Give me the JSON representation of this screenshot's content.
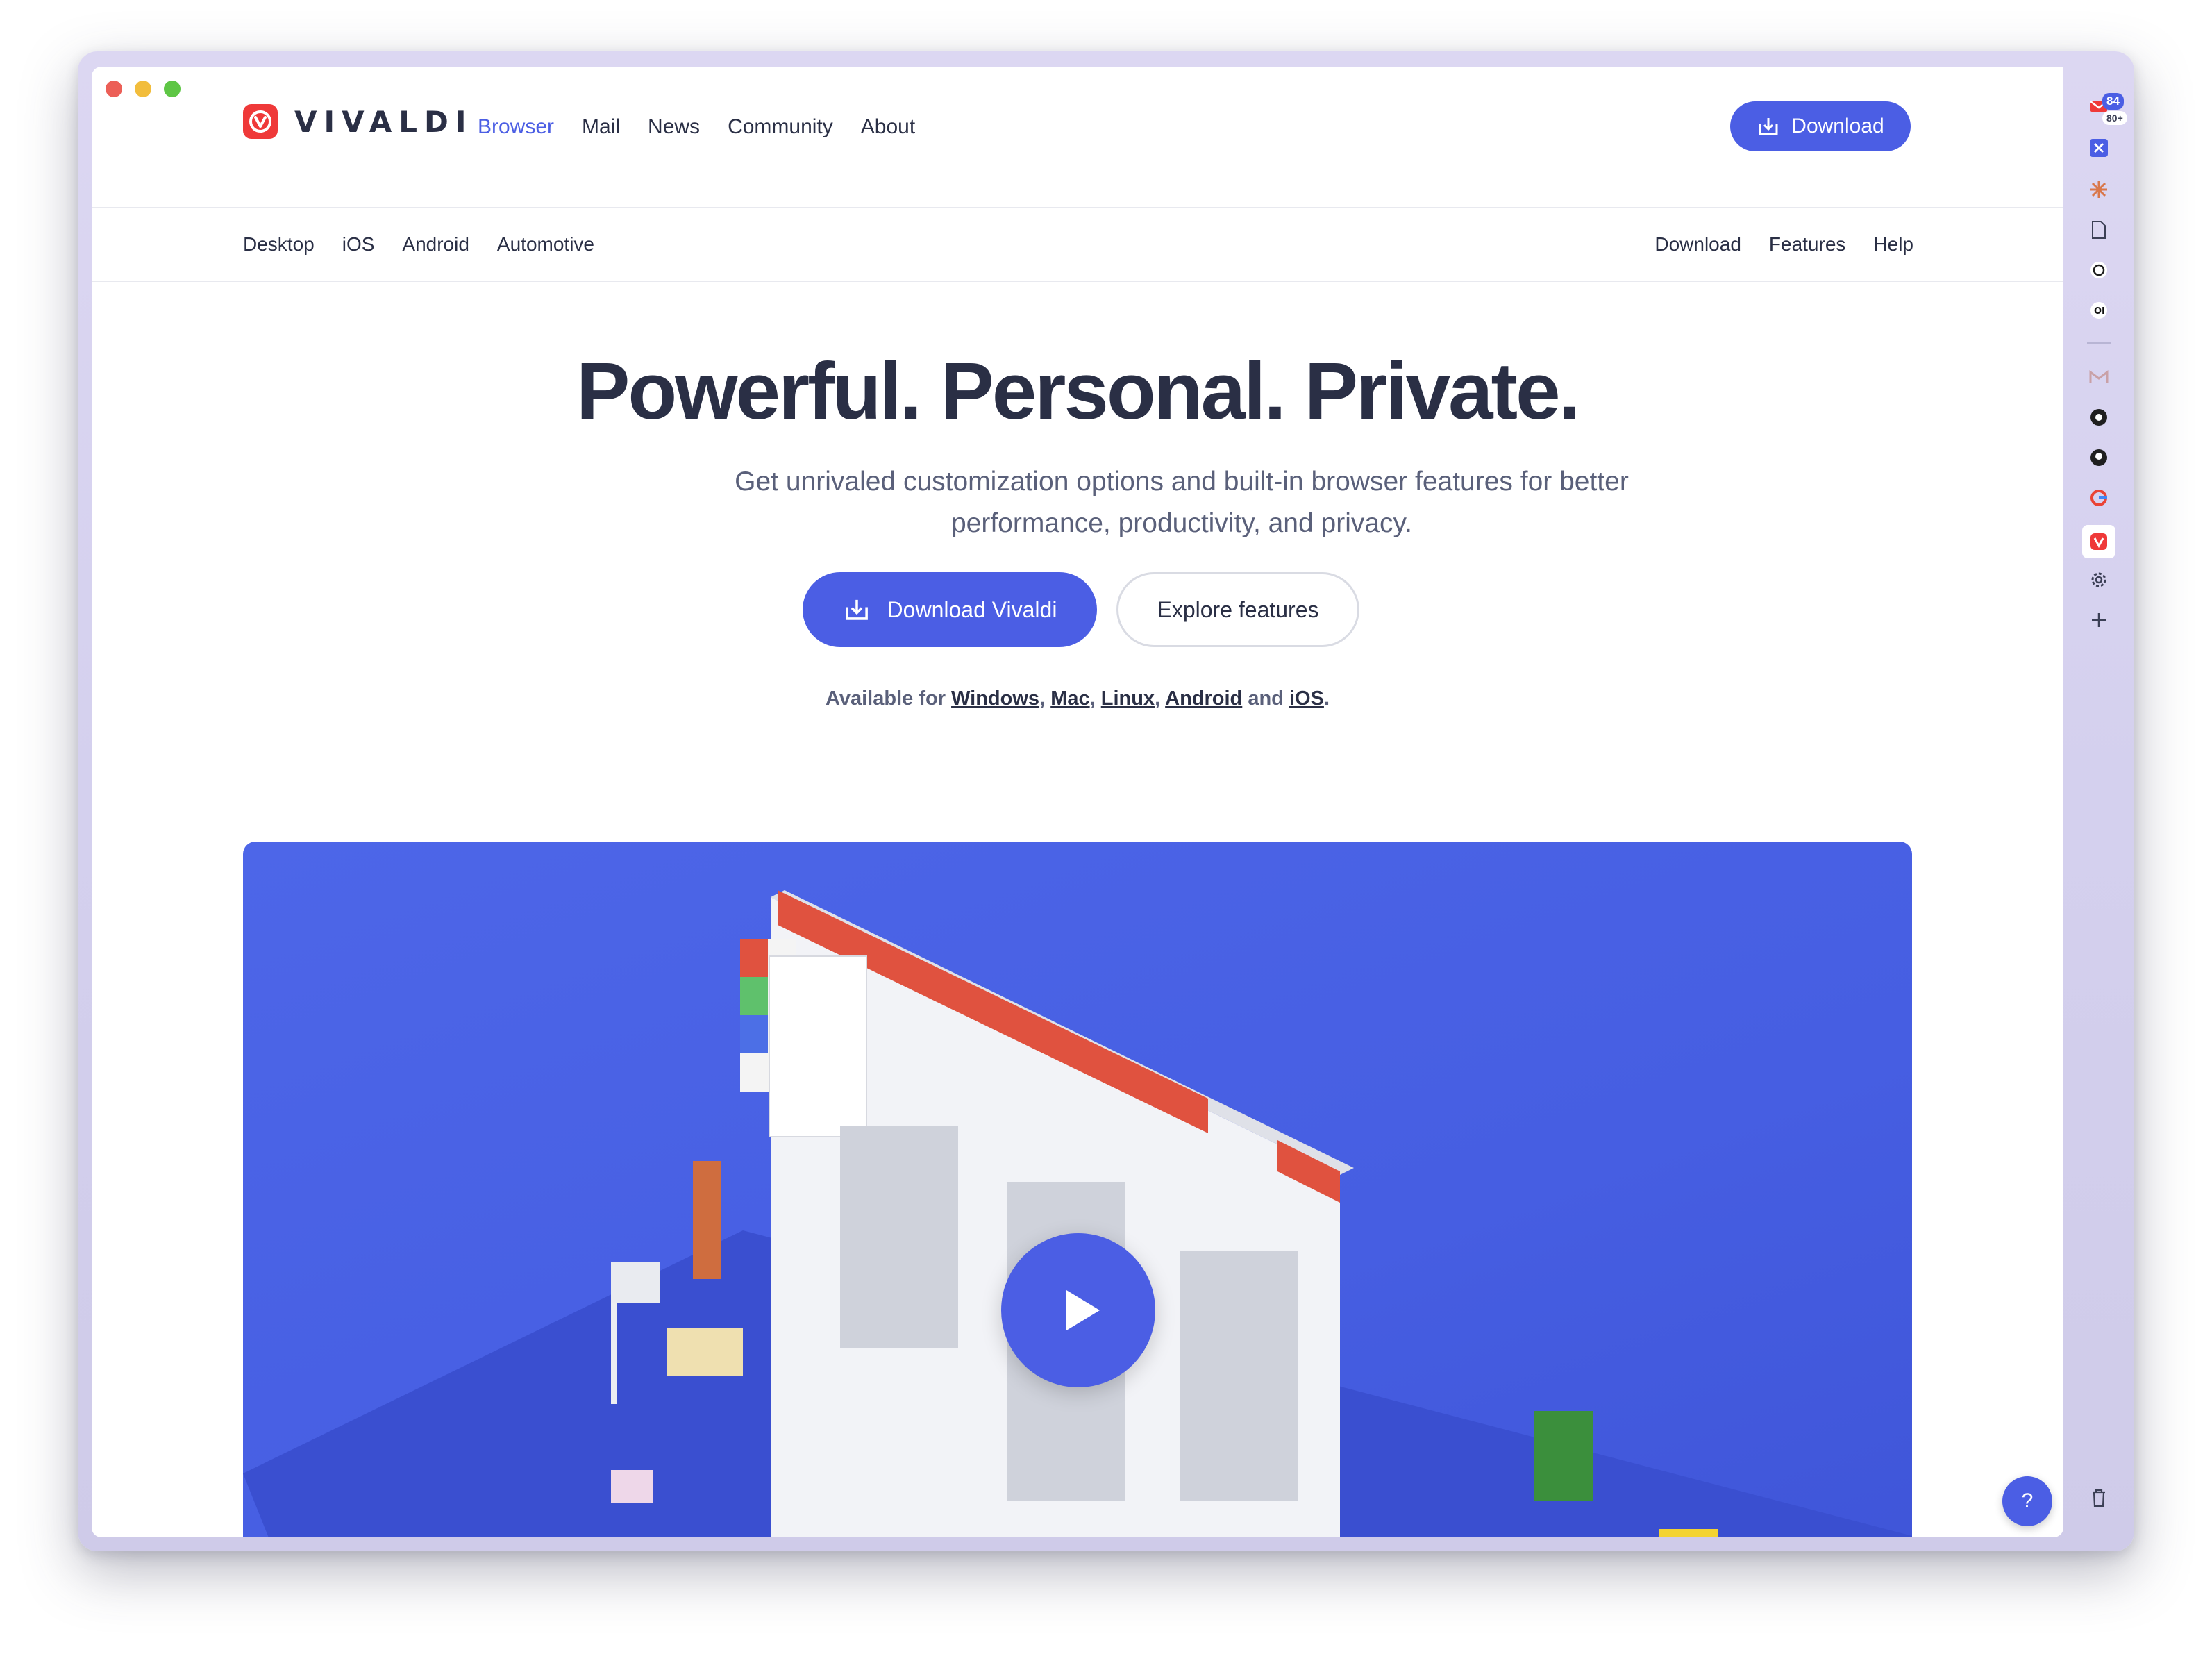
{
  "window": {
    "traffic_lights": [
      "close",
      "minimize",
      "maximize"
    ]
  },
  "nav": {
    "logo_text": "VIVALDI",
    "links": [
      {
        "label": "Browser",
        "active": true
      },
      {
        "label": "Mail",
        "active": false
      },
      {
        "label": "News",
        "active": false
      },
      {
        "label": "Community",
        "active": false
      },
      {
        "label": "About",
        "active": false
      }
    ],
    "download_button": "Download"
  },
  "subnav": {
    "left": [
      "Desktop",
      "iOS",
      "Android",
      "Automotive"
    ],
    "right": [
      "Download",
      "Features",
      "Help"
    ]
  },
  "hero": {
    "title": "Powerful. Personal. Private.",
    "subtitle": "Get unrivaled customization options and built-in browser features for better performance, productivity, and privacy.",
    "primary_button": "Download Vivaldi",
    "secondary_button": "Explore features",
    "available_prefix": "Available for",
    "platforms": [
      "Windows",
      "Mac",
      "Linux",
      "Android",
      "iOS"
    ],
    "available_joiner": "and"
  },
  "help_button": "?",
  "side_panel": {
    "mail_badge": "84",
    "mail_sub_badge": "80+",
    "icons": [
      "mail-icon",
      "x-icon",
      "star-burst-icon",
      "document-icon",
      "chatgpt-icon",
      "open-icon",
      "gmail-icon",
      "target-icon",
      "github-icon",
      "google-icon",
      "vivaldi-icon",
      "settings-icon",
      "add-panel-icon",
      "trash-icon"
    ]
  },
  "colors": {
    "accent": "#4b5ee4",
    "logo": "#ef3939",
    "text": "#2a2f45",
    "muted": "#5a607a"
  }
}
